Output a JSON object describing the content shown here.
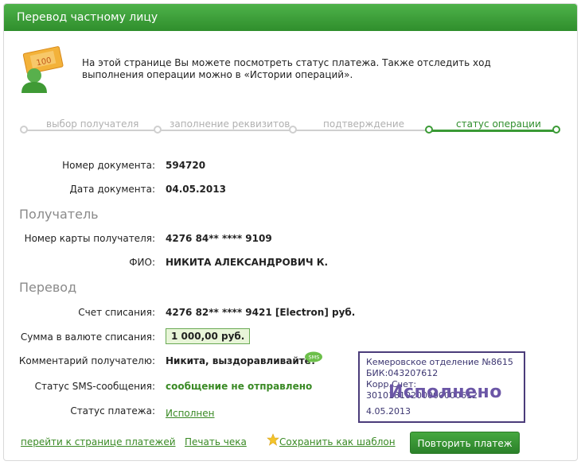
{
  "header": {
    "title": "Перевод частному лицу"
  },
  "intro": {
    "text": "На этой странице Вы можете посмотреть статус платежа. Также отследить ход выполнения операции можно в «Истории операций»."
  },
  "steps": [
    {
      "label": "выбор получателя",
      "active": false
    },
    {
      "label": "заполнение реквизитов",
      "active": false
    },
    {
      "label": "подтверждение",
      "active": false
    },
    {
      "label": "статус операции",
      "active": true
    }
  ],
  "document": {
    "number_label": "Номер документа:",
    "number": "594720",
    "date_label": "Дата документа:",
    "date": "04.05.2013"
  },
  "recipient": {
    "section_title": "Получатель",
    "card_label": "Номер карты получателя:",
    "card": "4276 84** **** 9109",
    "name_label": "ФИО:",
    "name": "НИКИТА АЛЕКСАНДРОВИЧ К."
  },
  "transfer": {
    "section_title": "Перевод",
    "account_label": "Счет списания:",
    "account": "4276 82** **** 9421  [Electron]  руб.",
    "amount_label": "Сумма в валюте списания:",
    "amount": "1 000,00  руб.",
    "comment_label": "Комментарий получателю:",
    "comment": "Никита, выздоравливайте!",
    "sms_badge": "SMS",
    "sms_status_label": "Статус SMS-сообщения:",
    "sms_status": "сообщение не отправлено",
    "status_label": "Статус платежа:",
    "status": "Исполнен"
  },
  "stamp": {
    "line1": "Кемеровское отделение №8615",
    "line2": "БИК:043207612",
    "line3": "Корр.Счет: 30101810200000000612",
    "big": "Исполнено",
    "date": "4.05.2013"
  },
  "footer": {
    "payments_link": "перейти к странице платежей",
    "print_link": "Печать чека",
    "template_link": "Сохранить как шаблон",
    "repeat_button": "Повторить платеж"
  },
  "colors": {
    "brand_green": "#2f8e2c",
    "stamp_purple": "#4b3c7a"
  }
}
